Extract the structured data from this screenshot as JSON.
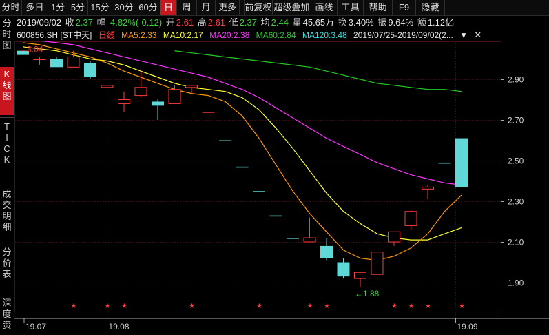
{
  "toolbar": {
    "buttons": [
      "分时",
      "多日",
      "1分",
      "5分",
      "15分",
      "30分",
      "60分",
      "日",
      "周",
      "月",
      "更多",
      "前复权",
      "超级叠加",
      "画线",
      "工具",
      "帮助",
      "F9",
      "隐藏"
    ],
    "active_index": 7
  },
  "sidebar": {
    "tabs": [
      "分时图",
      "K线图",
      "TICK",
      "成交明细",
      "分价表",
      "深度资"
    ],
    "active_index": 1
  },
  "info": {
    "date": "2019/09/02",
    "close_label": "收",
    "close": "2.37",
    "amp_label": "幅",
    "change": "-4.82%(-0.12)",
    "open_label": "开",
    "open": "2.61",
    "high_label": "高",
    "high": "2.61",
    "low_label": "低",
    "low": "2.37",
    "avg_label": "均",
    "avg": "2.44",
    "vol_label": "量",
    "volume": "45.65万",
    "turn_label": "换",
    "turnover": "3.40%",
    "swing_label": "振",
    "swing": "9.64%",
    "amount_label": "额",
    "amount": "1.12亿"
  },
  "mabar": {
    "code": "600856.SH [ST中天]",
    "period": "日线",
    "ma5": "MA5:2.33",
    "ma10": "MA10:2.17",
    "ma20": "MA20:2.38",
    "ma60": "MA60:2.84",
    "ma120": "MA120:3.48",
    "range": "2019/07/25-2019/09/02(2..."
  },
  "colors": {
    "up": "#ff3b3b",
    "down": "#5fd8d8",
    "ma5": "#ff9900",
    "ma10": "#ffff33",
    "ma20": "#ff33ff",
    "ma60": "#22cc22",
    "ma120": "#33dddd",
    "grid": "#3a0d0d"
  },
  "chart_data": {
    "type": "candlestick",
    "ylim": [
      1.78,
      3.04
    ],
    "yticks": [
      "2.90",
      "2.70",
      "2.50",
      "2.30",
      "2.10",
      "1.90"
    ],
    "ytick_values": [
      2.9,
      2.7,
      2.5,
      2.3,
      2.1,
      1.9
    ],
    "xticks": [
      "19.07",
      "19.08",
      "19.09"
    ],
    "xtick_index": [
      0,
      5,
      26
    ],
    "candles": [
      {
        "o": 3.04,
        "h": 3.04,
        "l": 3.02,
        "c": 3.02
      },
      {
        "o": 3.0,
        "h": 3.01,
        "l": 2.97,
        "c": 3.0
      },
      {
        "o": 3.0,
        "h": 3.01,
        "l": 2.96,
        "c": 2.96
      },
      {
        "o": 2.96,
        "h": 3.04,
        "l": 2.96,
        "c": 3.01
      },
      {
        "o": 2.98,
        "h": 2.99,
        "l": 2.9,
        "c": 2.91
      },
      {
        "o": 2.86,
        "h": 2.9,
        "l": 2.85,
        "c": 2.87
      },
      {
        "o": 2.78,
        "h": 2.84,
        "l": 2.74,
        "c": 2.8
      },
      {
        "o": 2.82,
        "h": 2.94,
        "l": 2.81,
        "c": 2.86
      },
      {
        "o": 2.79,
        "h": 2.8,
        "l": 2.7,
        "c": 2.77
      },
      {
        "o": 2.78,
        "h": 2.87,
        "l": 2.78,
        "c": 2.85
      },
      {
        "o": 2.86,
        "h": 2.87,
        "l": 2.83,
        "c": 2.87
      },
      {
        "o": 2.74,
        "h": 2.74,
        "l": 2.74,
        "c": 2.74
      },
      {
        "o": 2.6,
        "h": 2.6,
        "l": 2.6,
        "c": 2.6
      },
      {
        "o": 2.47,
        "h": 2.47,
        "l": 2.47,
        "c": 2.47
      },
      {
        "o": 2.35,
        "h": 2.35,
        "l": 2.35,
        "c": 2.35
      },
      {
        "o": 2.23,
        "h": 2.23,
        "l": 2.23,
        "c": 2.23
      },
      {
        "o": 2.12,
        "h": 2.12,
        "l": 2.12,
        "c": 2.12
      },
      {
        "o": 2.1,
        "h": 2.22,
        "l": 2.1,
        "c": 2.12
      },
      {
        "o": 2.08,
        "h": 2.12,
        "l": 2.01,
        "c": 2.02
      },
      {
        "o": 2.0,
        "h": 2.02,
        "l": 1.92,
        "c": 1.93
      },
      {
        "o": 1.92,
        "h": 1.95,
        "l": 1.88,
        "c": 1.95
      },
      {
        "o": 1.94,
        "h": 2.05,
        "l": 1.93,
        "c": 2.05
      },
      {
        "o": 2.1,
        "h": 2.15,
        "l": 2.08,
        "c": 2.15
      },
      {
        "o": 2.18,
        "h": 2.26,
        "l": 2.16,
        "c": 2.25
      },
      {
        "o": 2.36,
        "h": 2.38,
        "l": 2.31,
        "c": 2.37
      },
      {
        "o": 2.49,
        "h": 2.49,
        "l": 2.49,
        "c": 2.49
      },
      {
        "o": 2.61,
        "h": 2.61,
        "l": 2.37,
        "c": 2.37
      }
    ],
    "ma5": [
      3.08,
      3.07,
      3.05,
      3.03,
      3.01,
      2.98,
      2.94,
      2.91,
      2.88,
      2.85,
      2.83,
      2.82,
      2.79,
      2.72,
      2.61,
      2.48,
      2.35,
      2.24,
      2.15,
      2.06,
      2.02,
      2.01,
      2.03,
      2.07,
      2.14,
      2.25,
      2.33
    ],
    "ma10": [
      3.06,
      3.05,
      3.04,
      3.02,
      3.0,
      2.99,
      2.97,
      2.94,
      2.91,
      2.88,
      2.86,
      2.85,
      2.84,
      2.81,
      2.75,
      2.66,
      2.56,
      2.45,
      2.34,
      2.25,
      2.19,
      2.14,
      2.12,
      2.11,
      2.11,
      2.14,
      2.17
    ],
    "ma20": [
      3.1,
      3.09,
      3.08,
      3.07,
      3.05,
      3.03,
      3.01,
      2.99,
      2.97,
      2.95,
      2.93,
      2.91,
      2.88,
      2.85,
      2.81,
      2.76,
      2.71,
      2.66,
      2.61,
      2.57,
      2.53,
      2.49,
      2.46,
      2.43,
      2.41,
      2.39,
      2.38
    ],
    "ma60": [
      null,
      null,
      null,
      null,
      null,
      null,
      null,
      null,
      null,
      3.04,
      3.03,
      3.02,
      3.01,
      3.0,
      2.99,
      2.98,
      2.97,
      2.96,
      2.94,
      2.92,
      2.9,
      2.88,
      2.87,
      2.86,
      2.85,
      2.85,
      2.84
    ],
    "low_mark": {
      "index": 20,
      "label": "1.88"
    },
    "high_mark": {
      "index": 0,
      "label": "3.04"
    },
    "star_index": [
      3,
      5,
      6,
      10,
      14,
      17,
      18,
      22,
      23,
      24,
      26
    ]
  }
}
